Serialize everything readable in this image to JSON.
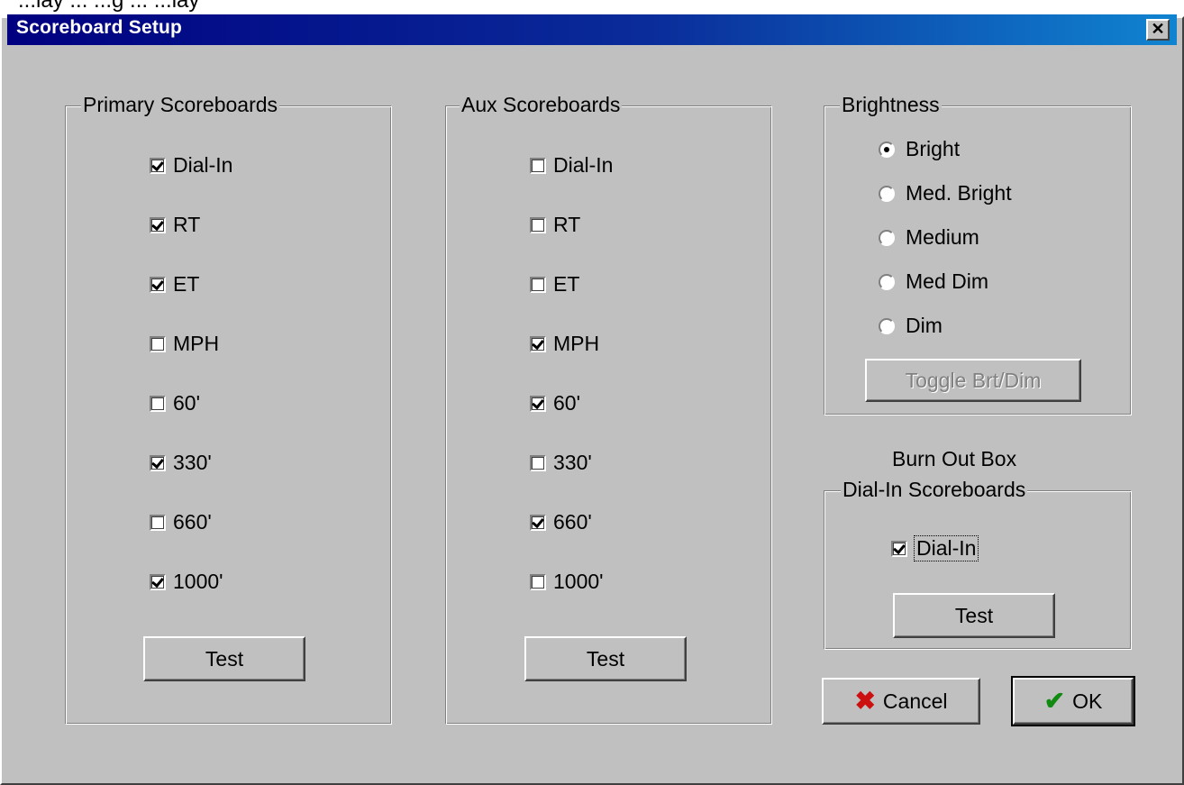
{
  "window": {
    "title": "Scoreboard Setup"
  },
  "primary": {
    "legend": "Primary Scoreboards",
    "items": [
      {
        "label": "Dial-In",
        "checked": true
      },
      {
        "label": "RT",
        "checked": true
      },
      {
        "label": "ET",
        "checked": true
      },
      {
        "label": "MPH",
        "checked": false
      },
      {
        "label": "60'",
        "checked": false
      },
      {
        "label": "330'",
        "checked": true
      },
      {
        "label": "660'",
        "checked": false
      },
      {
        "label": "1000'",
        "checked": true
      }
    ],
    "test_label": "Test"
  },
  "aux": {
    "legend": "Aux Scoreboards",
    "items": [
      {
        "label": "Dial-In",
        "checked": false
      },
      {
        "label": "RT",
        "checked": false
      },
      {
        "label": "ET",
        "checked": false
      },
      {
        "label": "MPH",
        "checked": true
      },
      {
        "label": "60'",
        "checked": true
      },
      {
        "label": "330'",
        "checked": false
      },
      {
        "label": "660'",
        "checked": true
      },
      {
        "label": "1000'",
        "checked": false
      }
    ],
    "test_label": "Test"
  },
  "brightness": {
    "legend": "Brightness",
    "options": [
      {
        "label": "Bright",
        "selected": true
      },
      {
        "label": "Med. Bright",
        "selected": false
      },
      {
        "label": "Medium",
        "selected": false
      },
      {
        "label": "Med Dim",
        "selected": false
      },
      {
        "label": "Dim",
        "selected": false
      }
    ],
    "toggle_label": "Toggle Brt/Dim"
  },
  "burnout": {
    "caption": "Burn Out Box",
    "legend": "Dial-In Scoreboards",
    "item": {
      "label": "Dial-In",
      "checked": true
    },
    "test_label": "Test"
  },
  "actions": {
    "cancel_label": "Cancel",
    "ok_label": "OK"
  },
  "colors": {
    "title_start": "#000080",
    "title_end": "#1084d0",
    "face": "#c0c0c0",
    "cancel_icon": "#cc1010",
    "ok_icon": "#108a10"
  },
  "icons": {
    "cancel": "x-icon",
    "ok": "checkmark-icon"
  }
}
